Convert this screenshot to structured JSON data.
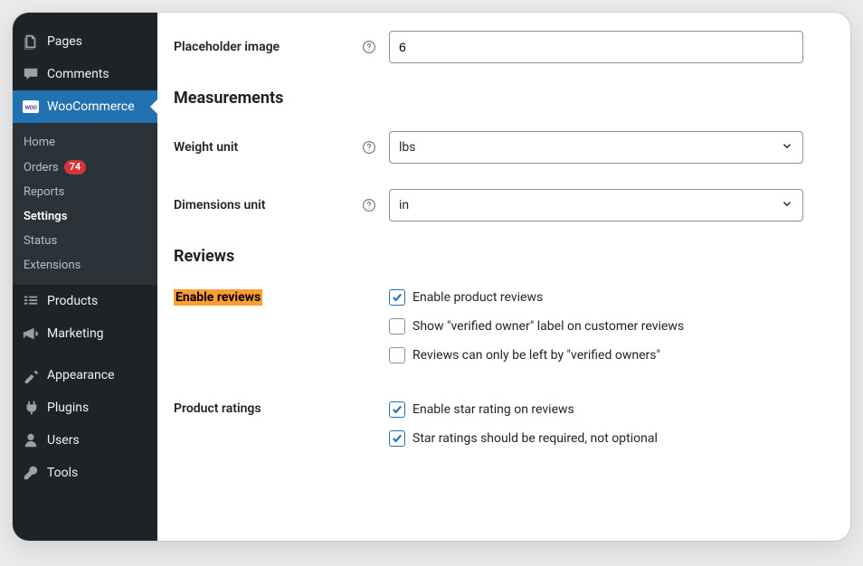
{
  "sidebar": {
    "items": [
      {
        "label": "Pages",
        "icon": "pages"
      },
      {
        "label": "Comments",
        "icon": "comments"
      },
      {
        "label": "WooCommerce",
        "icon": "woo",
        "active": true
      },
      {
        "label": "Products",
        "icon": "products"
      },
      {
        "label": "Marketing",
        "icon": "marketing"
      },
      {
        "label": "Appearance",
        "icon": "appearance"
      },
      {
        "label": "Plugins",
        "icon": "plugins"
      },
      {
        "label": "Users",
        "icon": "users"
      },
      {
        "label": "Tools",
        "icon": "tools"
      }
    ],
    "submenu": [
      {
        "label": "Home"
      },
      {
        "label": "Orders",
        "badge": "74"
      },
      {
        "label": "Reports"
      },
      {
        "label": "Settings",
        "current": true
      },
      {
        "label": "Status"
      },
      {
        "label": "Extensions"
      }
    ]
  },
  "form": {
    "placeholder_image_label": "Placeholder image",
    "placeholder_image_value": "6",
    "measurements_heading": "Measurements",
    "weight_unit_label": "Weight unit",
    "weight_unit_value": "lbs",
    "dimensions_unit_label": "Dimensions unit",
    "dimensions_unit_value": "in",
    "reviews_heading": "Reviews",
    "enable_reviews_label": "Enable reviews",
    "product_ratings_label": "Product ratings",
    "checks": {
      "enable_reviews": "Enable product reviews",
      "verified_label": "Show \"verified owner\" label on customer reviews",
      "verified_only": "Reviews can only be left by \"verified owners\"",
      "star_rating": "Enable star rating on reviews",
      "star_required": "Star ratings should be required, not optional"
    }
  }
}
